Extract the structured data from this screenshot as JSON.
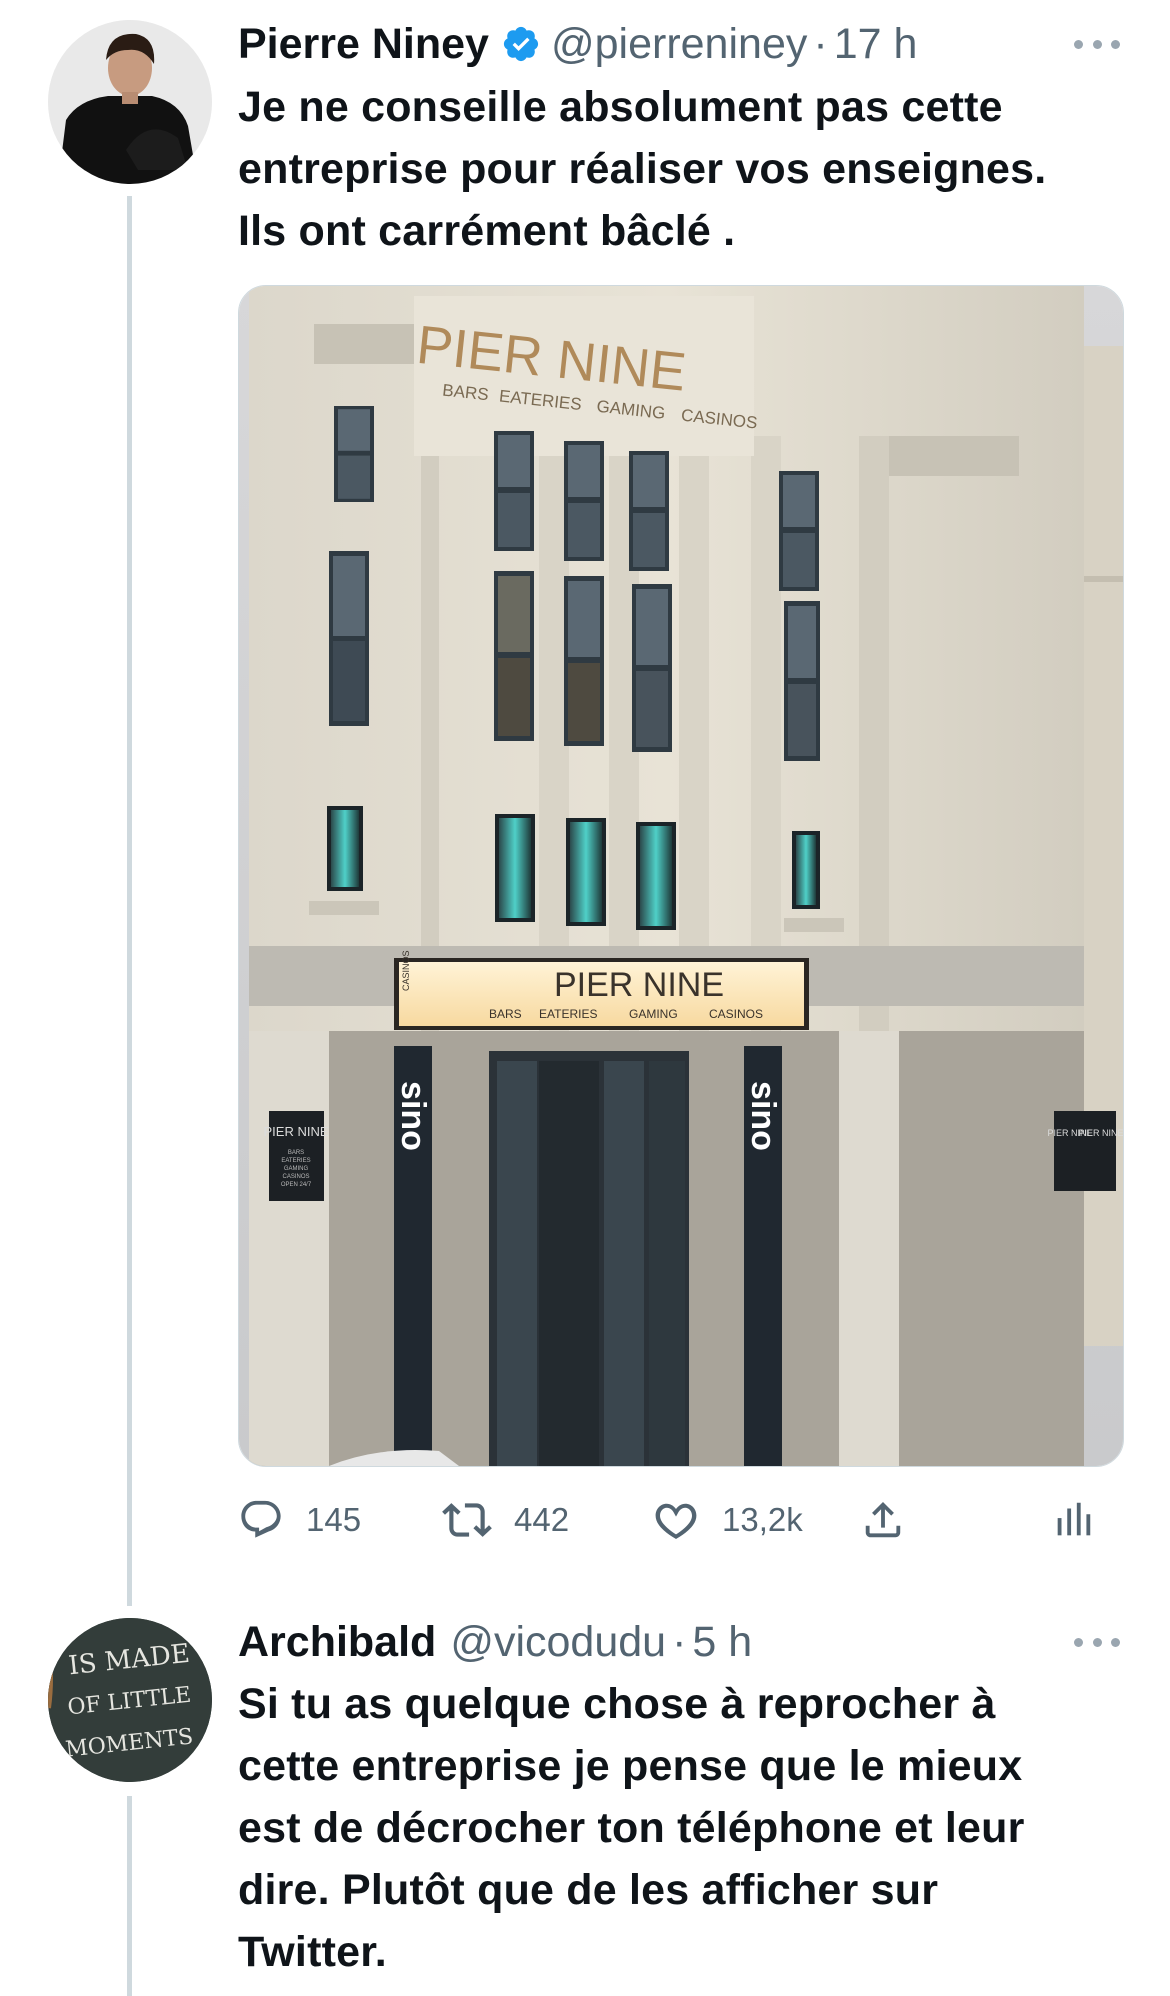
{
  "tweets": [
    {
      "author": {
        "name": "Pierre Niney",
        "handle": "@pierreniney",
        "verified": true
      },
      "separator": "·",
      "time": "17 h",
      "text": "Je ne conseille absolument pas cette\nentreprise pour réaliser vos enseignes.\nIls ont carrément bâclé .",
      "media": {
        "description_icon": "photo",
        "sign_top": {
          "title": "PIER NINE",
          "subtitle": [
            "BARS",
            "EATERIES",
            "GAMING",
            "CASINOS"
          ]
        },
        "marquee": {
          "title": "PIER NINE",
          "subtitle": [
            "BARS",
            "EATERIES",
            "GAMING",
            "CASINOS"
          ],
          "side": "CASINOS"
        },
        "vertical_sign": "sino",
        "left_board": {
          "title": "PIER NINE",
          "lines": [
            "BARS",
            "EATERIES",
            "GAMING",
            "CASINOS",
            "OPEN 24/7"
          ]
        },
        "right_board": {
          "title": "PIER NINE",
          "title2": "PIER NINE"
        }
      },
      "actions": {
        "replies": "145",
        "retweets": "442",
        "likes": "13,2k"
      }
    },
    {
      "author": {
        "name": "Archibald",
        "handle": "@vicodudu",
        "verified": false,
        "avatar_text": "IS MADE\nOF LITTLE\nMOMENTS"
      },
      "separator": "·",
      "time": "5 h",
      "text": "Si tu as quelque chose à reprocher à\ncette entreprise je pense que le mieux\nest de décrocher ton téléphone et leur\ndire. Plutôt que de les afficher sur\nTwitter."
    }
  ],
  "colors": {
    "text": "#0f1419",
    "secondary": "#536471",
    "verified": "#1d9bf0",
    "thread_line": "#cfd9de"
  }
}
